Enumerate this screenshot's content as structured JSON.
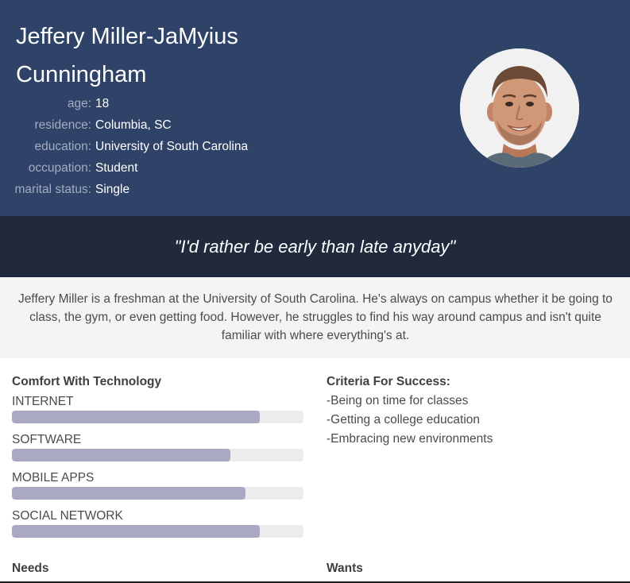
{
  "persona": {
    "name": "Jeffery Miller-JaMyius Cunningham",
    "details": [
      {
        "label": "age:",
        "value": "18"
      },
      {
        "label": "residence:",
        "value": "Columbia, SC"
      },
      {
        "label": "education:",
        "value": "University of South Carolina"
      },
      {
        "label": "occupation:",
        "value": "Student"
      },
      {
        "label": "marital status:",
        "value": "Single"
      }
    ],
    "quote": "\"I'd rather be early than late anyday\"",
    "bio": "Jeffery Miller is a freshman at the University of South Carolina. He's always on campus whether it be going to class, the gym, or even getting food. However, he struggles to find his way around campus and isn't quite familiar with where everything's at."
  },
  "technology": {
    "title": "Comfort With Technology",
    "items": [
      {
        "label": "INTERNET",
        "percent": 85
      },
      {
        "label": "SOFTWARE",
        "percent": 75
      },
      {
        "label": "MOBILE APPS",
        "percent": 80
      },
      {
        "label": "SOCIAL NETWORK",
        "percent": 85
      }
    ]
  },
  "success": {
    "title": "Criteria For Success:",
    "items": [
      "-Being on time for classes",
      "-Getting a college education",
      "-Embracing new environments"
    ]
  },
  "sections": {
    "needs_title": "Needs",
    "wants_title": "Wants"
  },
  "colors": {
    "header_bg": "#2f4268",
    "quote_bg": "#202a3c",
    "bar_fill": "#a9a9c4",
    "bar_track": "#ececec"
  }
}
